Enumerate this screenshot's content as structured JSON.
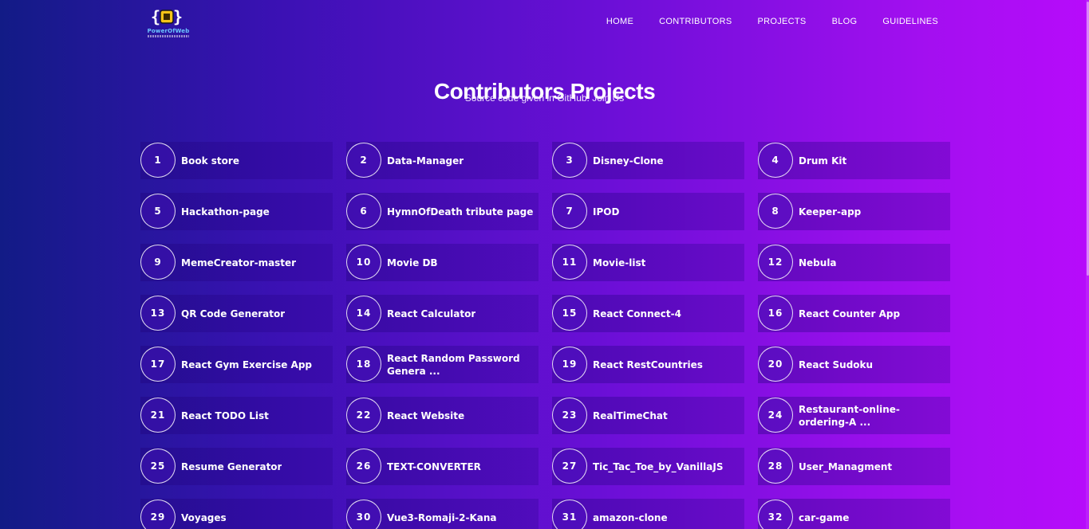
{
  "brand": {
    "logo_icon": "code-braces-icon",
    "logo_text": "PowerOfWeb"
  },
  "nav": {
    "items": [
      {
        "label": "HOME"
      },
      {
        "label": "CONTRIBUTORS"
      },
      {
        "label": "PROJECTS"
      },
      {
        "label": "BLOG"
      },
      {
        "label": "GUIDELINES"
      }
    ]
  },
  "hero": {
    "title": "Contributors Projects",
    "subtitle": "Source code given in GitHub. Join Us"
  },
  "projects": [
    {
      "number": "1",
      "name": "Book store"
    },
    {
      "number": "2",
      "name": "Data-Manager"
    },
    {
      "number": "3",
      "name": "Disney-Clone"
    },
    {
      "number": "4",
      "name": "Drum Kit"
    },
    {
      "number": "5",
      "name": "Hackathon-page"
    },
    {
      "number": "6",
      "name": "HymnOfDeath tribute page"
    },
    {
      "number": "7",
      "name": "IPOD"
    },
    {
      "number": "8",
      "name": "Keeper-app"
    },
    {
      "number": "9",
      "name": "MemeCreator-master"
    },
    {
      "number": "10",
      "name": "Movie DB"
    },
    {
      "number": "11",
      "name": "Movie-list"
    },
    {
      "number": "12",
      "name": "Nebula"
    },
    {
      "number": "13",
      "name": "QR Code Generator"
    },
    {
      "number": "14",
      "name": "React Calculator"
    },
    {
      "number": "15",
      "name": "React Connect-4"
    },
    {
      "number": "16",
      "name": "React Counter App"
    },
    {
      "number": "17",
      "name": "React Gym Exercise App"
    },
    {
      "number": "18",
      "name": "React Random Password Genera ..."
    },
    {
      "number": "19",
      "name": "React RestCountries"
    },
    {
      "number": "20",
      "name": "React Sudoku"
    },
    {
      "number": "21",
      "name": "React TODO List"
    },
    {
      "number": "22",
      "name": "React Website"
    },
    {
      "number": "23",
      "name": "RealTimeChat"
    },
    {
      "number": "24",
      "name": "Restaurant-online-ordering-A ..."
    },
    {
      "number": "25",
      "name": "Resume Generator"
    },
    {
      "number": "26",
      "name": "TEXT-CONVERTER"
    },
    {
      "number": "27",
      "name": "Tic_Tac_Toe_by_VanillaJS"
    },
    {
      "number": "28",
      "name": "User_Managment"
    },
    {
      "number": "29",
      "name": "Voyages"
    },
    {
      "number": "30",
      "name": "Vue3-Romaji-2-Kana"
    },
    {
      "number": "31",
      "name": "amazon-clone"
    },
    {
      "number": "32",
      "name": "car-game"
    }
  ],
  "colors": {
    "gradient_start": "#121b86",
    "gradient_end": "#b70bfb",
    "logo_accent": "#f5c518"
  }
}
